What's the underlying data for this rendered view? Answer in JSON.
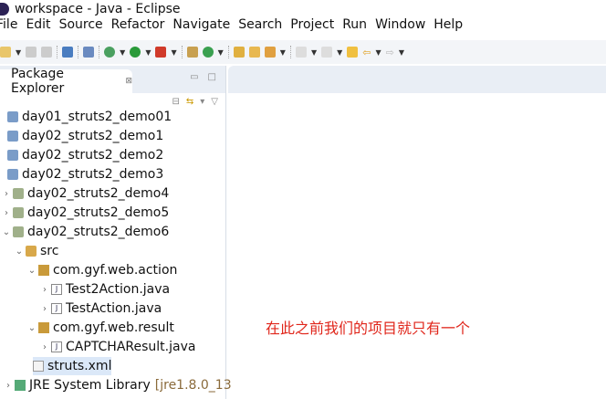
{
  "window": {
    "title": "workspace - Java - Eclipse"
  },
  "menu": [
    "File",
    "Edit",
    "Source",
    "Refactor",
    "Navigate",
    "Search",
    "Project",
    "Run",
    "Window",
    "Help"
  ],
  "panel": {
    "title": "Package Explorer"
  },
  "tree": [
    {
      "label": "day01_struts2_demo01",
      "icon": "project-icon"
    },
    {
      "label": "day02_struts2_demo1",
      "icon": "project-icon"
    },
    {
      "label": "day02_struts2_demo2",
      "icon": "project-icon"
    },
    {
      "label": "day02_struts2_demo3",
      "icon": "project-icon"
    },
    {
      "label": "day02_struts2_demo4",
      "icon": "web-project-icon"
    },
    {
      "label": "day02_struts2_demo5",
      "icon": "web-project-icon"
    },
    {
      "label": "day02_struts2_demo6",
      "icon": "web-project-icon"
    },
    {
      "label": "src",
      "icon": "source-folder-icon"
    },
    {
      "label": "com.gyf.web.action",
      "icon": "package-icon"
    },
    {
      "label": "Test2Action.java",
      "icon": "java-file-icon"
    },
    {
      "label": "TestAction.java",
      "icon": "java-file-icon"
    },
    {
      "label": "com.gyf.web.result",
      "icon": "package-icon"
    },
    {
      "label": "CAPTCHAResult.java",
      "icon": "java-file-icon"
    },
    {
      "label": "struts.xml",
      "icon": "xml-file-icon"
    },
    {
      "label": "JRE System Library",
      "suffix": "[jre1.8.0_13",
      "icon": "library-icon"
    }
  ],
  "annotation": "在此之前我们的项目就只有一个"
}
